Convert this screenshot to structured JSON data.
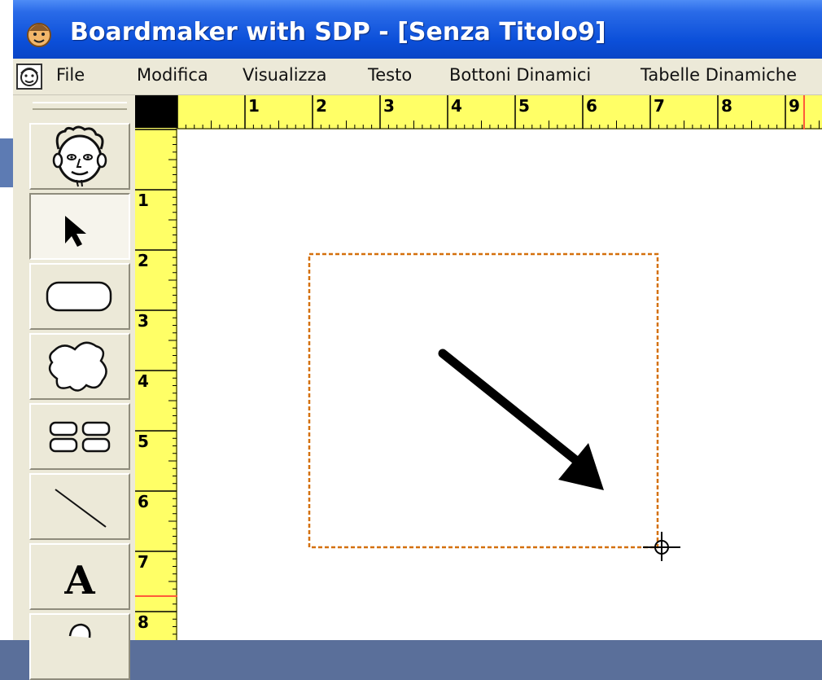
{
  "window": {
    "title": "Boardmaker with SDP - [Senza Titolo9]"
  },
  "menu": {
    "items": [
      "File",
      "Modifica",
      "Visualizza",
      "Testo",
      "Bottoni Dinamici",
      "Tabelle Dinamiche"
    ]
  },
  "toolbox": {
    "tools": [
      "symbol-finder",
      "pointer",
      "button",
      "freeform",
      "button-sequence",
      "line",
      "text",
      "color"
    ],
    "active_tool": "pointer",
    "text_tool_label": "A"
  },
  "rulers": {
    "horizontal_labels": [
      "1",
      "2",
      "3",
      "4",
      "5",
      "6",
      "7",
      "8",
      "9"
    ],
    "vertical_labels": [
      "1",
      "2",
      "3",
      "4",
      "5",
      "6",
      "7",
      "8"
    ],
    "units": "inch"
  },
  "colors": {
    "titlebar": "#0b4fd9",
    "ruler": "#ffff66",
    "selection_outline": "#d4700c",
    "ruler_marker": "#ff5a3a",
    "annotation_arrow": "#000000"
  }
}
